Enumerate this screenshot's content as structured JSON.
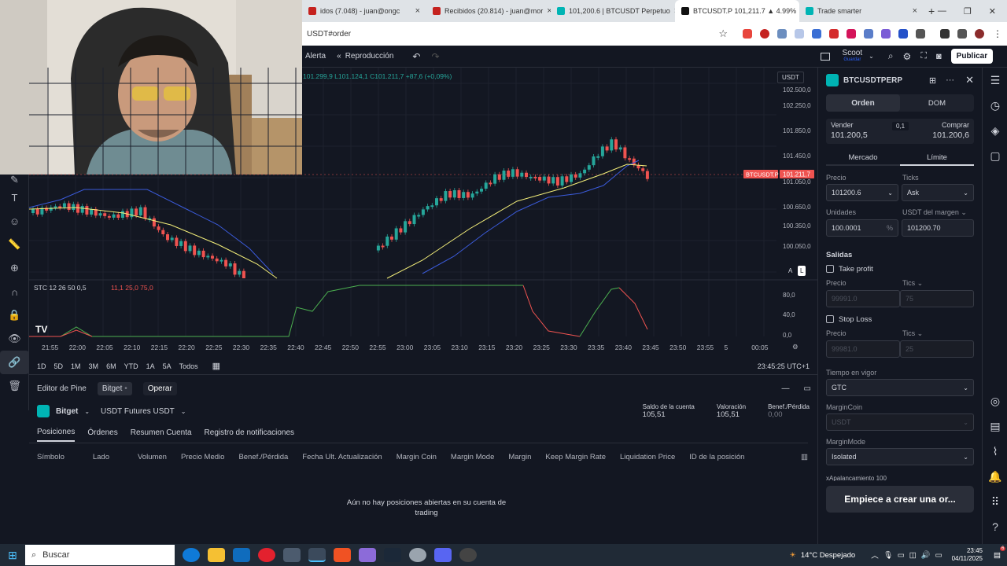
{
  "browser": {
    "tabs": [
      {
        "label": "idos (7.048) - juan@ongc",
        "color": "#c5221f"
      },
      {
        "label": "Recibidos (20.814) - juan@mor",
        "color": "#c5221f"
      },
      {
        "label": "101,200.6 | BTCUSDT Perpetuo",
        "color": "#00b4b4"
      },
      {
        "label": "BTCUSDT.P 101,211.7 ▲ 4.99%",
        "color": "#111111"
      },
      {
        "label": "Trade smarter",
        "color": "#00b4b4"
      }
    ],
    "url": "USDT#order",
    "window_controls": {
      "min": "—",
      "max": "❐",
      "close": "✕"
    }
  },
  "toolbar": {
    "alert": "Alerta",
    "replay": "Reproducción",
    "undo": "↶",
    "redo": "↷",
    "layout_name": "Scoot",
    "layout_status": "Guardar",
    "publish": "Publicar"
  },
  "chart": {
    "ohlc": "101.299,9 L101.124,1 C101.211,7 +87,6 (+0,09%)",
    "currency": "USDT",
    "price_labels": [
      "102.500,0",
      "102.250,0",
      "101.850,0",
      "101.450,0",
      "101.050,0",
      "100.650,0",
      "100.350,0",
      "100.050,0"
    ],
    "symbol_tag": "BTCUSDT.P",
    "current_price": "101.211,7",
    "indicator": "STC 12 26 50 0,5",
    "indicator_vals": "11,1  25,0  75,0",
    "osc_labels": [
      "80,0",
      "40,0",
      "0,0"
    ],
    "time_labels": [
      "21:55",
      "22:00",
      "22:05",
      "22:10",
      "22:15",
      "22:20",
      "22:25",
      "22:30",
      "22:35",
      "22:40",
      "22:45",
      "22:50",
      "22:55",
      "23:00",
      "23:05",
      "23:10",
      "23:15",
      "23:20",
      "23:25",
      "23:30",
      "23:35",
      "23:40",
      "23:45",
      "23:50",
      "23:55",
      "5",
      "00:05"
    ],
    "btn_a": "A",
    "btn_l": "L",
    "logo": "TV"
  },
  "ranges": [
    "1D",
    "5D",
    "1M",
    "3M",
    "6M",
    "YTD",
    "1A",
    "5A",
    "Todos"
  ],
  "clock": "23:45:25 UTC+1",
  "bottom": {
    "tabs": [
      "Editor de Pine",
      "Bitget",
      "Operar"
    ],
    "broker": "Bitget",
    "account": "USDT Futures USDT",
    "stats": [
      {
        "label": "Saldo de la cuenta",
        "value": "105,51"
      },
      {
        "label": "Valoración",
        "value": "105,51"
      },
      {
        "label": "Benef./Pérdida",
        "value": "0,00"
      }
    ],
    "subtabs": [
      "Posiciones",
      "Órdenes",
      "Resumen Cuenta",
      "Registro de notificaciones"
    ],
    "columns": [
      "Símbolo",
      "Lado",
      "Volumen",
      "Precio Medio",
      "Benef./Pérdida",
      "Fecha Ult. Actualización",
      "Margin Coin",
      "Margin Mode",
      "Margin",
      "Keep Margin Rate",
      "Liquidation Price",
      "ID de la posición"
    ],
    "empty": "Aún no hay posiciones abiertas en su cuenta de trading"
  },
  "order": {
    "symbol": "BTCUSDTPERP",
    "modes": [
      "Orden",
      "DOM"
    ],
    "sell_label": "Vender",
    "sell_price": "101.200,5",
    "spread": "0,1",
    "buy_label": "Comprar",
    "buy_price": "101.200,6",
    "types": [
      "Mercado",
      "Límite"
    ],
    "price_label": "Precio",
    "ticks_label": "Ticks",
    "price_value": "101200.6",
    "ticks_value": "Ask",
    "units_label": "Unidades",
    "margin_label": "USDT del margen",
    "units_value": "100.0001",
    "pct": "%",
    "margin_value": "101200.70",
    "exits": "Salidas",
    "tp": "Take profit",
    "tp_price_label": "Precio",
    "tp_tics_label": "Tics",
    "tp_price": "99991.0",
    "tp_tics": "75",
    "sl": "Stop Loss",
    "sl_price_label": "Precio",
    "sl_tics_label": "Tics",
    "sl_price": "99981.0",
    "sl_tics": "25",
    "tif_label": "Tiempo en vigor",
    "tif": "GTC",
    "margincoin_label": "MarginCoin",
    "margincoin": "USDT",
    "marginmode_label": "MarginMode",
    "marginmode": "Isolated",
    "leverage": "xApalancamiento 100",
    "cta": "Empiece a crear una or..."
  },
  "taskbar": {
    "search": "Buscar",
    "weather": "14°C  Despejado",
    "time": "23:45",
    "date": "04/11/2025",
    "badge": "6"
  },
  "colors": {
    "up": "#26a69a",
    "down": "#ef5350",
    "accent": "#2962ff",
    "upper_band": "#3b5bdb",
    "ema": "#f5f07a",
    "stc": "#4caf50"
  }
}
